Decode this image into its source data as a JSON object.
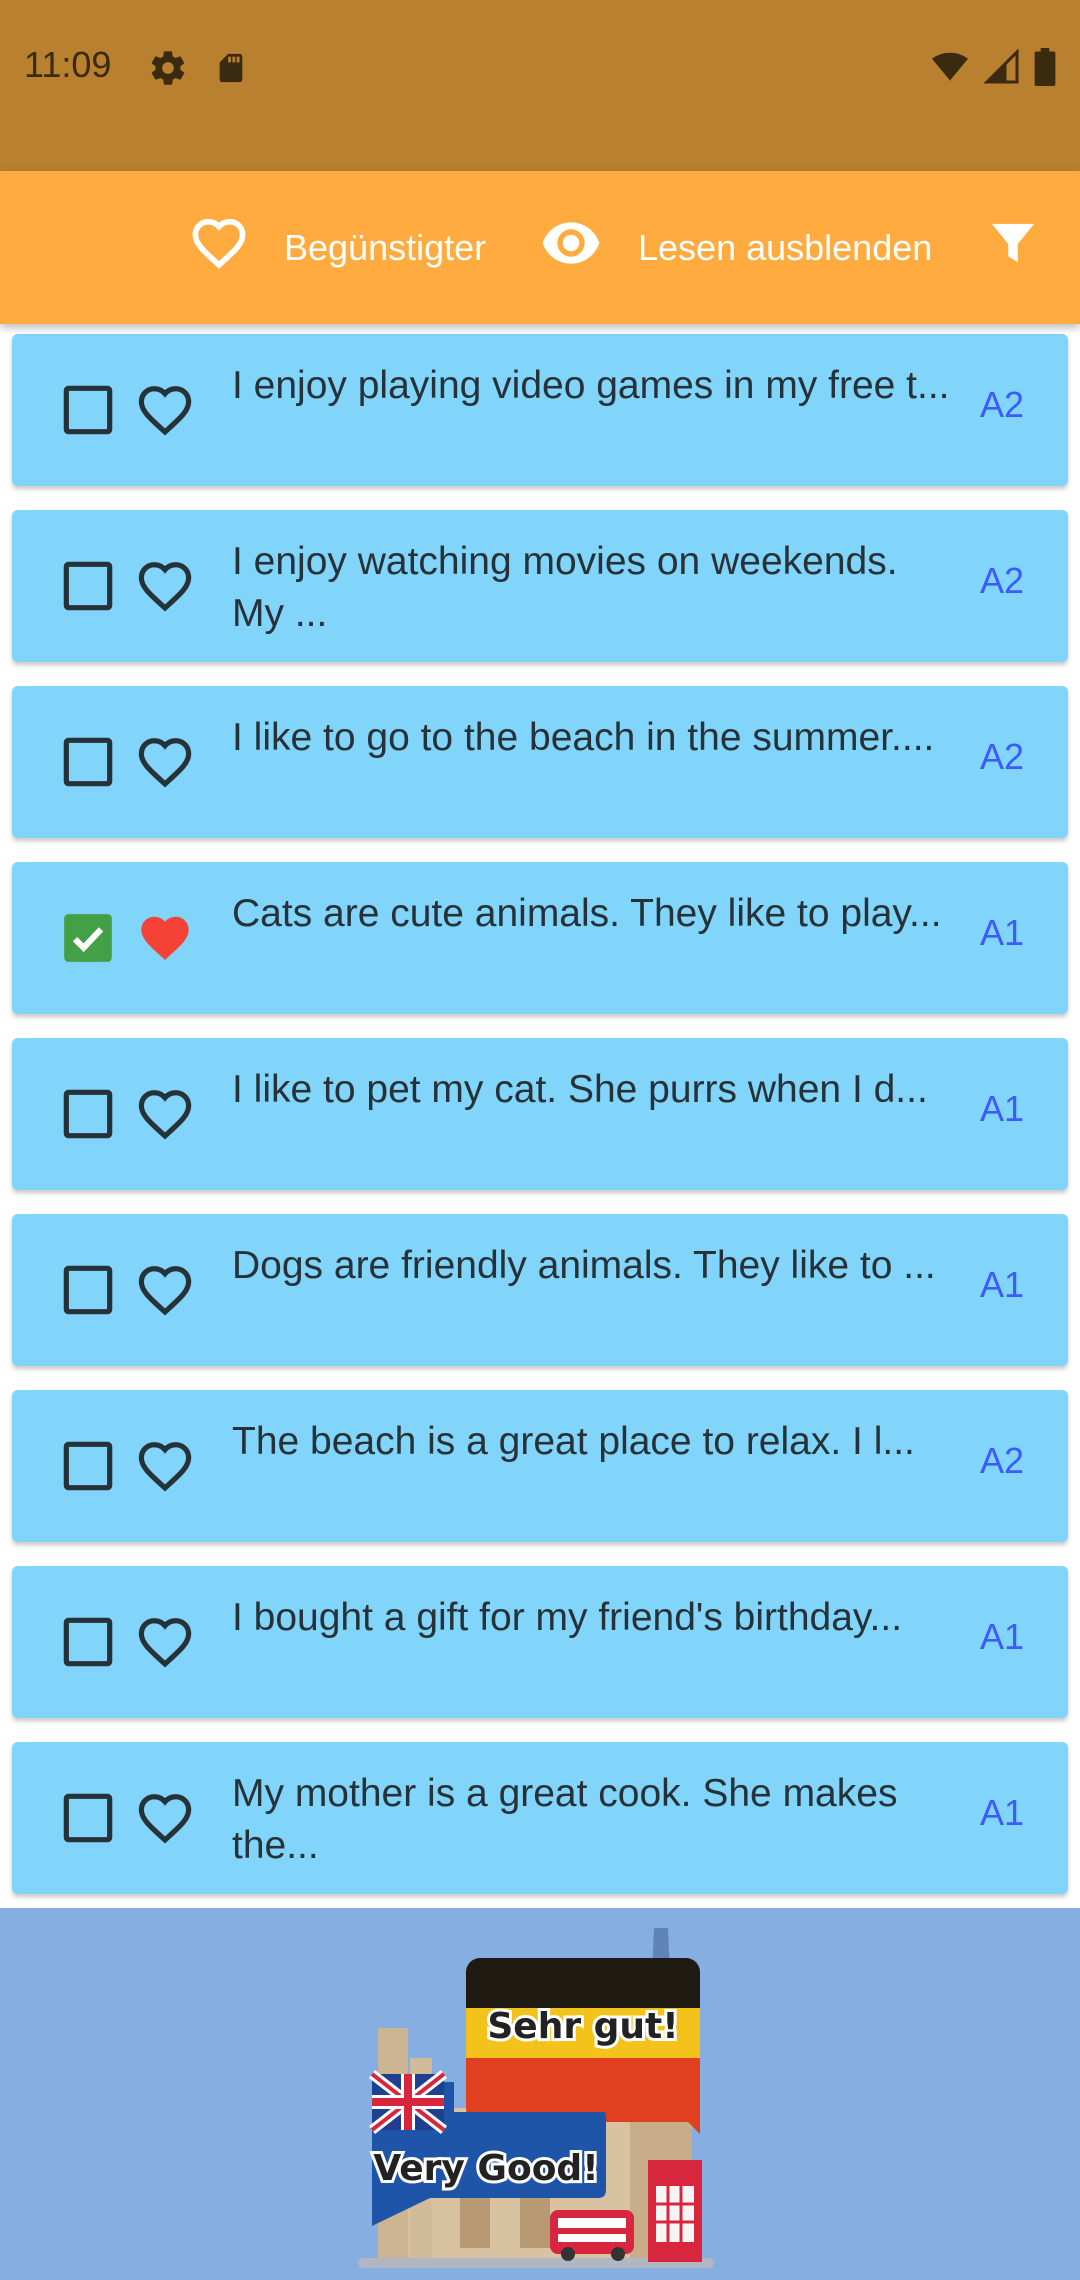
{
  "status": {
    "time": "11:09",
    "icons": [
      "gear-icon",
      "sd-card-icon",
      "wifi-icon",
      "signal-icon",
      "battery-icon"
    ]
  },
  "toolbar": {
    "favorites_label": "Begünstigter",
    "hide_read_label": "Lesen ausblenden",
    "filter_icon": "filter-icon"
  },
  "items": [
    {
      "text": "I enjoy playing video games in my free t...",
      "level": "A2",
      "checked": false,
      "favorite": false
    },
    {
      "text": "I enjoy watching movies on weekends. My ...",
      "level": "A2",
      "checked": false,
      "favorite": false
    },
    {
      "text": "I like to go to the beach in the summer....",
      "level": "A2",
      "checked": false,
      "favorite": false
    },
    {
      "text": "Cats are cute animals. They like to play...",
      "level": "A1",
      "checked": true,
      "favorite": true
    },
    {
      "text": "I like to pet my cat. She purrs when I d...",
      "level": "A1",
      "checked": false,
      "favorite": false
    },
    {
      "text": "Dogs are friendly animals. They like to ...",
      "level": "A1",
      "checked": false,
      "favorite": false
    },
    {
      "text": "The beach is a great place to relax. I l...",
      "level": "A2",
      "checked": false,
      "favorite": false
    },
    {
      "text": "I bought a gift for my friend's birthday...",
      "level": "A1",
      "checked": false,
      "favorite": false
    },
    {
      "text": "My mother is a great cook. She makes the...",
      "level": "A1",
      "checked": false,
      "favorite": false
    }
  ],
  "banner": {
    "german_text": "Sehr gut!",
    "english_text": "Very Good!"
  },
  "colors": {
    "status_bar": "#b8802f",
    "toolbar": "#ffab40",
    "card": "#81d4fa",
    "level_text": "#3d5afe",
    "check_green": "#43a047",
    "heart_red": "#f44336",
    "banner_bg": "#86aee0"
  }
}
